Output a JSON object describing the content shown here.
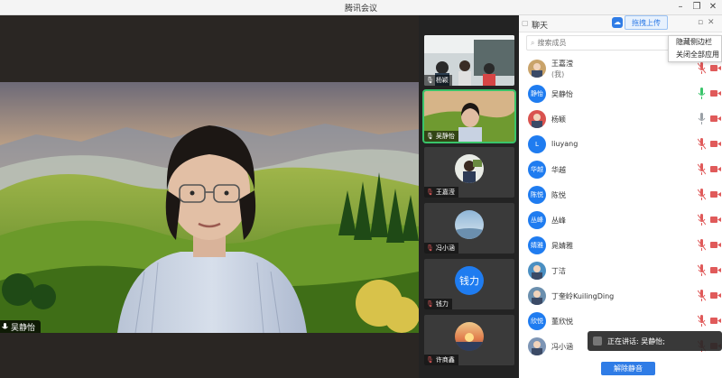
{
  "window": {
    "title": "腾讯会议"
  },
  "stage": {
    "speaker_name": "吴静怡"
  },
  "thumbnails": [
    {
      "name": "杨颖",
      "mic": "on"
    },
    {
      "name": "吴静怡",
      "mic": "on"
    },
    {
      "name": "王嘉滢",
      "mic": "muted"
    },
    {
      "name": "冯小涵",
      "mic": "muted"
    },
    {
      "name": "钱力",
      "mic": "muted",
      "avatar_text": "钱力"
    },
    {
      "name": "许商鑫",
      "mic": "muted"
    }
  ],
  "chat": {
    "header": "聊天",
    "upload_label": "拖拽上传"
  },
  "members": {
    "search_placeholder": "搜索成员",
    "list": [
      {
        "name": "王嘉滢",
        "sub": "(我)",
        "mic": "muted",
        "avatar": "photo"
      },
      {
        "name": "吴静怡",
        "mic": "active",
        "avatar_text": "静怡"
      },
      {
        "name": "杨颖",
        "mic": "on",
        "avatar": "photo"
      },
      {
        "name": "liuyang",
        "mic": "muted",
        "avatar_text": "L"
      },
      {
        "name": "华越",
        "mic": "muted",
        "avatar_text": "华越"
      },
      {
        "name": "陈悦",
        "mic": "muted",
        "avatar_text": "陈悦"
      },
      {
        "name": "丛峰",
        "mic": "muted",
        "avatar_text": "丛峰"
      },
      {
        "name": "晁婧雅",
        "mic": "muted",
        "avatar_text": "婧雅"
      },
      {
        "name": "丁洁",
        "mic": "muted",
        "avatar": "photo"
      },
      {
        "name": "丁奎岭KuilingDing",
        "mic": "muted",
        "avatar": "photo"
      },
      {
        "name": "董欣悦",
        "mic": "muted",
        "avatar_text": "欣悦"
      },
      {
        "name": "冯小涵",
        "mic": "muted",
        "avatar": "photo"
      }
    ]
  },
  "context_menu": {
    "items": [
      "隐藏侧边栏",
      "关闭全部应用"
    ]
  },
  "toast": {
    "text": "正在讲话: 吴静怡;"
  },
  "footer": {
    "mute_all_label": "解除静音"
  },
  "colors": {
    "accent": "#2f7ce6",
    "active_green": "#39c46a",
    "muted_red": "#e05a5a"
  }
}
